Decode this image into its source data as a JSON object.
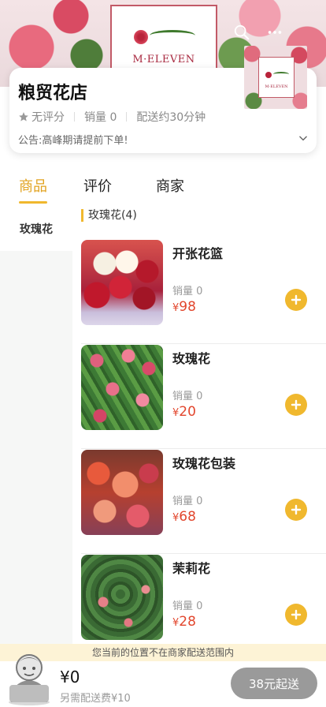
{
  "banner": {
    "logo_text": "M·ELEVEN"
  },
  "shop": {
    "name": "粮贸花店",
    "rating": "无评分",
    "sales": "销量 0",
    "delivery_time": "配送约30分钟",
    "notice": "公告:高峰期请提前下单!"
  },
  "tabs": [
    {
      "label": "商品",
      "active": true
    },
    {
      "label": "评价",
      "active": false
    },
    {
      "label": "商家",
      "active": false
    }
  ],
  "sidebar": {
    "items": [
      {
        "label": "玫瑰花"
      }
    ]
  },
  "category": {
    "title": "玫瑰花(4)"
  },
  "products": [
    {
      "name": "开张花篮",
      "sales": "销量 0",
      "currency": "¥",
      "price": "98"
    },
    {
      "name": "玫瑰花",
      "sales": "销量 0",
      "currency": "¥",
      "price": "20"
    },
    {
      "name": "玫瑰花包装",
      "sales": "销量 0",
      "currency": "¥",
      "price": "68"
    },
    {
      "name": "茉莉花",
      "sales": "销量 0",
      "currency": "¥",
      "price": "28"
    }
  ],
  "delivery_notice": "您当前的位置不在商家配送范围内",
  "cart": {
    "total": "¥0",
    "delivery_fee": "另需配送费¥10",
    "checkout_label": "38元起送"
  },
  "colors": {
    "accent": "#f0b82e",
    "price": "#e2462d",
    "checkout_disabled": "#9a9a9a",
    "notice_bg": "#fdf3d6"
  }
}
